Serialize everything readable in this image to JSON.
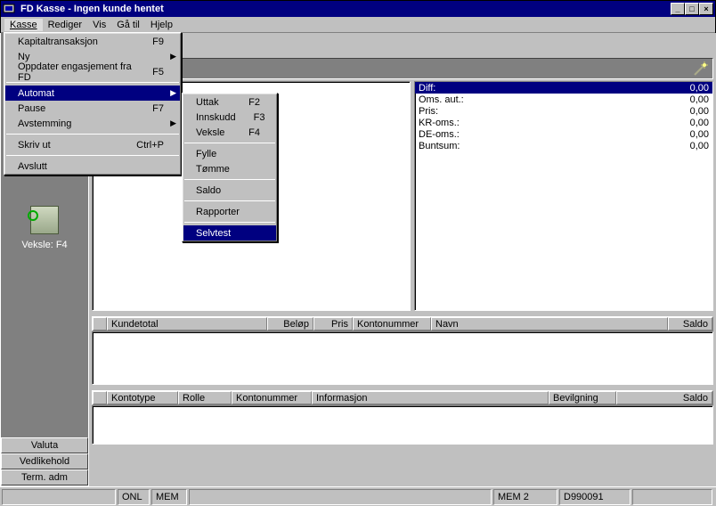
{
  "title": "FD Kasse - Ingen kunde hentet",
  "menubar": [
    "Kasse",
    "Rediger",
    "Vis",
    "Gå til",
    "Hjelp"
  ],
  "menu_kasse": {
    "items": [
      {
        "label": "Kapitaltransaksjon",
        "shortcut": "F9"
      },
      {
        "label": "Ny",
        "submenu": true
      },
      {
        "label": "Oppdater engasjement fra FD",
        "shortcut": "F5"
      }
    ],
    "mid": [
      {
        "label": "Automat",
        "submenu": true,
        "hl": true
      },
      {
        "label": "Pause",
        "shortcut": "F7"
      },
      {
        "label": "Avstemming",
        "submenu": true
      }
    ],
    "print": {
      "label": "Skriv ut",
      "shortcut": "Ctrl+P"
    },
    "exit": {
      "label": "Avslutt"
    }
  },
  "submenu_automat": [
    {
      "label": "Uttak",
      "shortcut": "F2"
    },
    {
      "label": "Innskudd",
      "shortcut": "F3"
    },
    {
      "label": "Veksle",
      "shortcut": "F4"
    },
    "-",
    {
      "label": "Fylle"
    },
    {
      "label": "Tømme"
    },
    "-",
    {
      "label": "Saldo"
    },
    "-",
    {
      "label": "Rapporter"
    },
    "-",
    {
      "label": "Selvtest",
      "hl": true
    }
  ],
  "sidebar": {
    "icon_label": "Veksle: F4",
    "buttons": [
      "Valuta",
      "Vedlikehold",
      "Term. adm"
    ]
  },
  "summary": [
    {
      "label": "Diff:",
      "value": "0,00",
      "hl": true
    },
    {
      "label": "Oms. aut.:",
      "value": "0,00"
    },
    {
      "label": "Pris:",
      "value": "0,00"
    },
    {
      "label": "KR-oms.:",
      "value": "0,00"
    },
    {
      "label": "DE-oms.:",
      "value": "0,00"
    },
    {
      "label": "Buntsum:",
      "value": "0,00"
    }
  ],
  "table1_headers": [
    "Kundetotal",
    "Beløp",
    "Pris",
    "Kontonummer",
    "Navn",
    "Saldo"
  ],
  "table2_headers": [
    "Kontotype",
    "Rolle",
    "Kontonummer",
    "Informasjon",
    "Bevilgning",
    "Saldo"
  ],
  "status": {
    "onl": "ONL",
    "mem": "MEM",
    "mem2": "MEM  2",
    "code": "D990091"
  }
}
